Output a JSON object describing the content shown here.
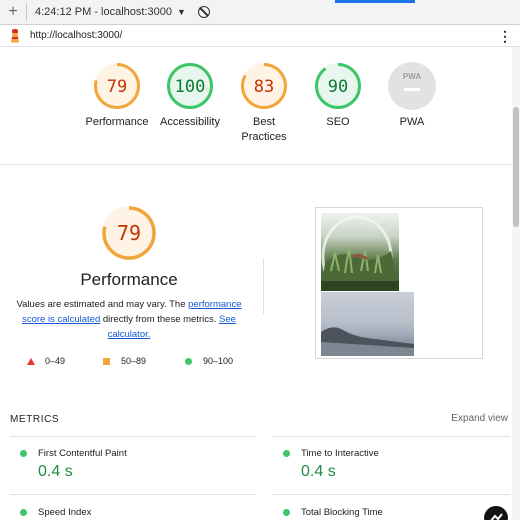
{
  "topbar": {
    "new_tab": "+",
    "session": "4:24:12 PM - localhost:3000",
    "caret": "▼"
  },
  "urlbar": {
    "url": "http://localhost:3000/",
    "menu": "⋮"
  },
  "scores": [
    {
      "name": "Performance",
      "value": "79",
      "color": "#f2a53b",
      "fill": 0.79
    },
    {
      "name": "Accessibility",
      "value": "100",
      "color": "#3ec469",
      "fill": 1.0
    },
    {
      "name": "Best Practices",
      "value": "83",
      "color": "#f2a53b",
      "fill": 0.83
    },
    {
      "name": "SEO",
      "value": "90",
      "color": "#3ec469",
      "fill": 0.9
    },
    {
      "name": "PWA",
      "value": "PWA",
      "color": "#e0e0e0",
      "fill": 0
    }
  ],
  "performance": {
    "score": "79",
    "title": "Performance",
    "desc_1": "Values are estimated and may vary. The ",
    "link_1": "performance score is calculated",
    "desc_2": " directly from these metrics. ",
    "link_2": "See calculator."
  },
  "legend": {
    "fail": "0–49",
    "average": "50–89",
    "pass": "90–100"
  },
  "metrics": {
    "heading": "METRICS",
    "expand": "Expand view",
    "items": [
      {
        "label": "First Contentful Paint",
        "value": "0.4 s"
      },
      {
        "label": "Time to Interactive",
        "value": "0.4 s"
      },
      {
        "label": "Speed Index",
        "value": ""
      },
      {
        "label": "Total Blocking Time",
        "value": ""
      }
    ]
  },
  "colors": {
    "pass": "#3ec469",
    "average": "#f2a53b",
    "fail": "#e0392b",
    "link": "#1558d6"
  }
}
